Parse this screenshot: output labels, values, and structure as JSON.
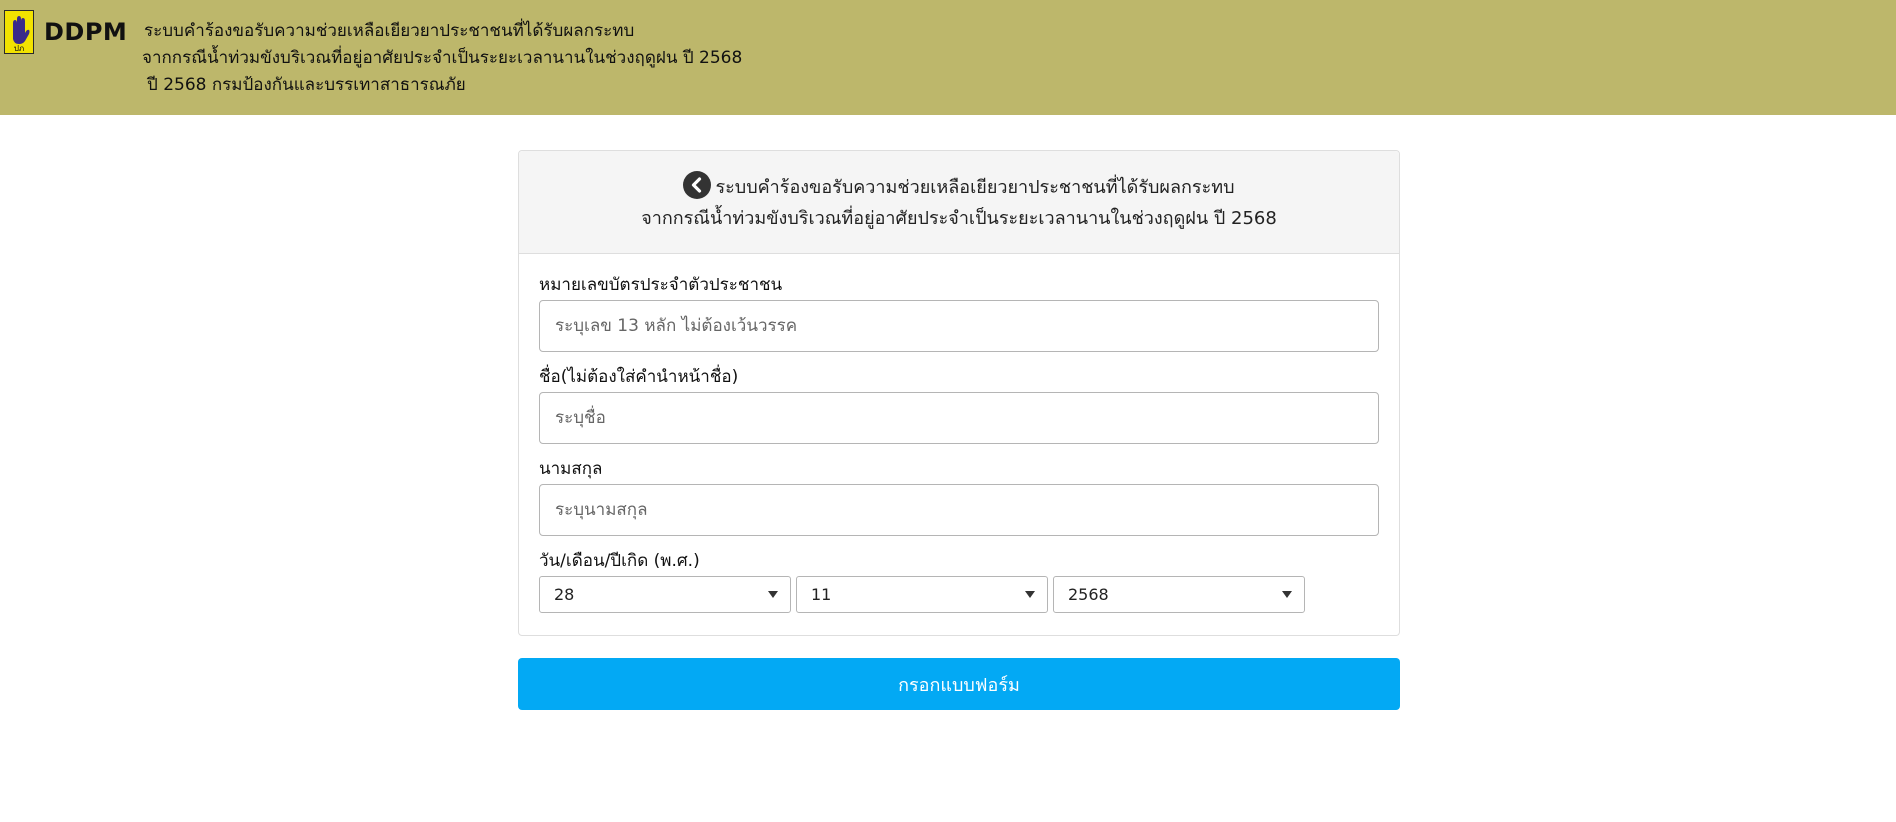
{
  "header": {
    "brand": "DDPM",
    "line1": "ระบบคำร้องขอรับความช่วยเหลือเยียวยาประชาชนที่ได้รับผลกระทบ",
    "line2": "จากกรณีน้ำท่วมขังบริเวณที่อยู่อาศัยประจำเป็นระยะเวลานานในช่วงฤดูฝน ปี 2568",
    "line3": "ปี 2568 กรมป้องกันและบรรเทาสาธารณภัย",
    "logo_text": "ปภ",
    "bg_color": "#bdb76b"
  },
  "card": {
    "title_line1": "ระบบคำร้องขอรับความช่วยเหลือเยียวยาประชาชนที่ได้รับผลกระทบ",
    "title_line2": "จากกรณีน้ำท่วมขังบริเวณที่อยู่อาศัยประจำเป็นระยะเวลานานในช่วงฤดูฝน ปี 2568",
    "back_icon": "chevron-left-circle-icon"
  },
  "form": {
    "id_label": "หมายเลขบัตรประจำตัวประชาชน",
    "id_placeholder": "ระบุเลข 13 หลัก ไม่ต้องเว้นวรรค",
    "id_value": "",
    "name_label": "ชื่อ(ไม่ต้องใส่คำนำหน้าชื่อ)",
    "name_placeholder": "ระบุชื่อ",
    "name_value": "",
    "surname_label": "นามสกุล",
    "surname_placeholder": "ระบุนามสกุล",
    "surname_value": "",
    "dob_label": "วัน/เดือน/ปีเกิด (พ.ศ.)",
    "dob_day": "28",
    "dob_month": "11",
    "dob_year": "2568"
  },
  "submit": {
    "label": "กรอกแบบฟอร์ม",
    "color": "#03a9f4"
  }
}
